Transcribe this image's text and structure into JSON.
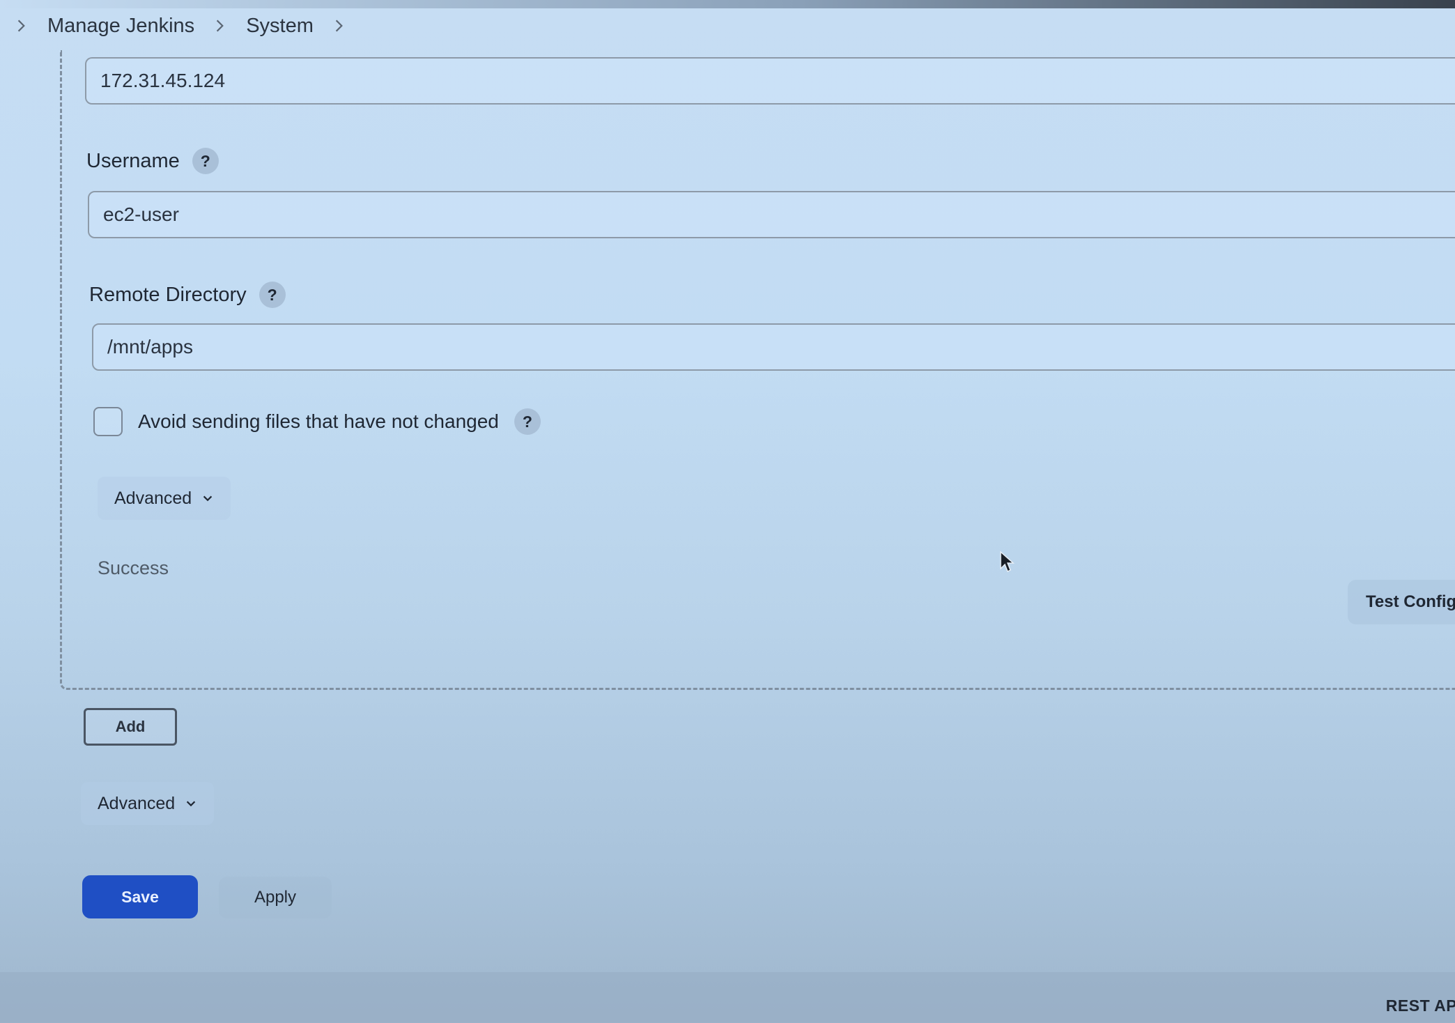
{
  "breadcrumb": {
    "items": [
      "Manage Jenkins",
      "System"
    ]
  },
  "server": {
    "hostname_value": "172.31.45.124",
    "username_label": "Username",
    "username_value": "ec2-user",
    "remote_directory_label": "Remote Directory",
    "remote_directory_value": "/mnt/apps",
    "avoid_sending_label": "Avoid sending files that have not changed",
    "avoid_sending_checked": false,
    "advanced_label": "Advanced",
    "status_text": "Success",
    "test_button_label": "Test Configu"
  },
  "help_label": "?",
  "add_button_label": "Add",
  "advanced_label": "Advanced",
  "save_label": "Save",
  "apply_label": "Apply",
  "footer": {
    "rest_api_label": "REST API"
  }
}
